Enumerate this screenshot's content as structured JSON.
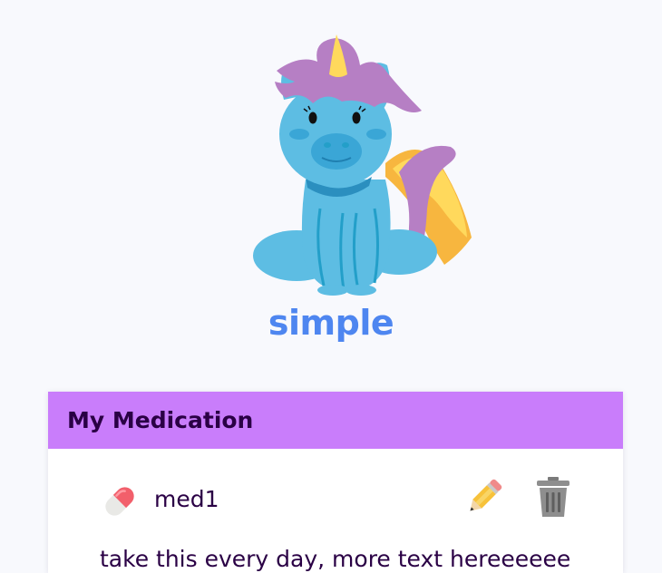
{
  "pet": {
    "name": "simple",
    "mascot_icon": "unicorn-mascot"
  },
  "medication_card": {
    "title": "My Medication",
    "header_color": "#c97dfb",
    "items": [
      {
        "name": "med1",
        "icon": "pill-icon",
        "edit_icon": "pencil-icon",
        "delete_icon": "trash-icon",
        "notes": "take this every day, more text hereeeeee"
      }
    ]
  },
  "colors": {
    "pet_name": "#4e86f0",
    "text": "#2a0045",
    "background": "#f8f9fd"
  }
}
